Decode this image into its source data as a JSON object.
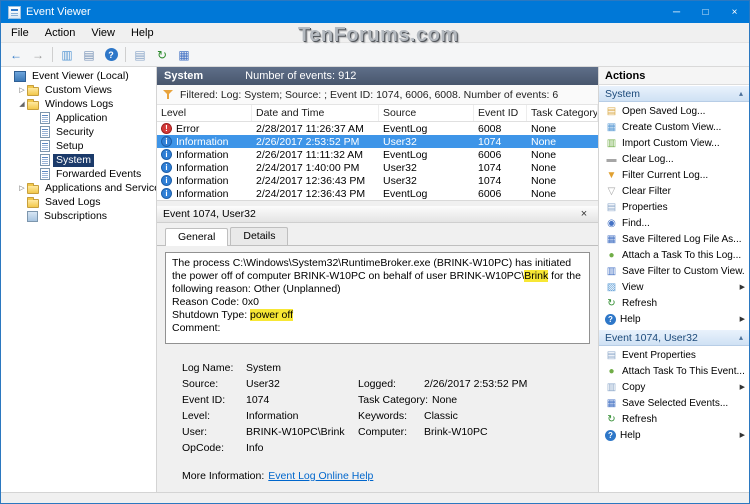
{
  "colors": {
    "titlebar": "#0078d7",
    "list_header_bar": "#4e5d76",
    "selection": "#3e95e8",
    "tree_selection": "#1b3a6a",
    "search_highlight": "#f7e735",
    "link": "#0066cc"
  },
  "window": {
    "title": "Event Viewer",
    "watermark": "TenForums.com",
    "menus": [
      "File",
      "Action",
      "View",
      "Help"
    ],
    "controls": [
      {
        "name": "minimize-button",
        "glyph": "─"
      },
      {
        "name": "maximize-button",
        "glyph": "□"
      },
      {
        "name": "close-button",
        "glyph": "×"
      }
    ]
  },
  "toolbar": [
    {
      "name": "back-icon",
      "glyph": "←",
      "color": "#2e77c8"
    },
    {
      "name": "forward-icon",
      "glyph": "→",
      "color": "#9a9a9a"
    },
    {
      "name": "separator"
    },
    {
      "name": "show-console-tree-icon",
      "glyph": "▥",
      "color": "#5b9bd5"
    },
    {
      "name": "export-list-icon",
      "glyph": "▤",
      "color": "#7a94b8"
    },
    {
      "name": "help-icon",
      "glyph": "?",
      "color": "#2e77c8",
      "circle": true
    },
    {
      "name": "separator"
    },
    {
      "name": "properties-icon",
      "glyph": "▤",
      "color": "#8aa6c8"
    },
    {
      "name": "refresh-icon",
      "glyph": "↻",
      "color": "#2e8b2e"
    },
    {
      "name": "save-icon",
      "glyph": "▦",
      "color": "#4472c4"
    }
  ],
  "tree": {
    "expander_glyphs": {
      "collapsed": "▷",
      "expanded": "◢"
    },
    "items": [
      {
        "label": "Event Viewer (Local)",
        "level": 0,
        "icon": "event-viewer-icon",
        "expander": ""
      },
      {
        "label": "Custom Views",
        "level": 1,
        "icon": "folder-icon",
        "expander": "collapsed"
      },
      {
        "label": "Windows Logs",
        "level": 1,
        "icon": "folder-icon",
        "expander": "expanded"
      },
      {
        "label": "Application",
        "level": 2,
        "icon": "log-icon",
        "expander": ""
      },
      {
        "label": "Security",
        "level": 2,
        "icon": "log-icon",
        "expander": ""
      },
      {
        "label": "Setup",
        "level": 2,
        "icon": "log-icon",
        "expander": ""
      },
      {
        "label": "System",
        "level": 2,
        "icon": "log-icon",
        "expander": "",
        "selected": true
      },
      {
        "label": "Forwarded Events",
        "level": 2,
        "icon": "log-icon",
        "expander": ""
      },
      {
        "label": "Applications and Services Logs",
        "level": 1,
        "icon": "folder-icon",
        "expander": "collapsed"
      },
      {
        "label": "Saved Logs",
        "level": 1,
        "icon": "folder-icon",
        "expander": ""
      },
      {
        "label": "Subscriptions",
        "level": 1,
        "icon": "subscriptions-icon",
        "expander": ""
      }
    ]
  },
  "list": {
    "title": "System",
    "events_count_label": "Number of events: 912",
    "filter_label": "Filtered: Log: System; Source: ; Event ID: 1074, 6006, 6008. Number of events: 6",
    "columns": [
      "Level",
      "Date and Time",
      "Source",
      "Event ID",
      "Task Category"
    ],
    "rows": [
      {
        "level": "Error",
        "datetime": "2/28/2017 11:26:37 AM",
        "source": "EventLog",
        "event_id": "6008",
        "task_category": "None"
      },
      {
        "level": "Information",
        "datetime": "2/26/2017 2:53:52 PM",
        "source": "User32",
        "event_id": "1074",
        "task_category": "None",
        "selected": true
      },
      {
        "level": "Information",
        "datetime": "2/26/2017 11:11:32 AM",
        "source": "EventLog",
        "event_id": "6006",
        "task_category": "None"
      },
      {
        "level": "Information",
        "datetime": "2/24/2017 1:40:00 PM",
        "source": "User32",
        "event_id": "1074",
        "task_category": "None"
      },
      {
        "level": "Information",
        "datetime": "2/24/2017 12:36:43 PM",
        "source": "User32",
        "event_id": "1074",
        "task_category": "None"
      },
      {
        "level": "Information",
        "datetime": "2/24/2017 12:36:43 PM",
        "source": "EventLog",
        "event_id": "6006",
        "task_category": "None"
      }
    ]
  },
  "detail": {
    "title": "Event 1074, User32",
    "close_glyph": "×",
    "tabs": [
      {
        "label": "General",
        "active": true
      },
      {
        "label": "Details",
        "active": false
      }
    ],
    "description": [
      [
        {
          "t": "The process C:\\Windows\\System32\\RuntimeBroker.exe (BRINK-W10PC) has initiated the power off of computer BRINK-W10PC on behalf of user BRINK-W10PC\\"
        },
        {
          "t": "Brink",
          "hl": true
        },
        {
          "t": " for the following reason: Other (Unplanned)"
        }
      ],
      [
        {
          "t": "Reason Code: 0x0"
        }
      ],
      [
        {
          "t": "Shutdown Type: "
        },
        {
          "t": "power off",
          "hl": true
        }
      ],
      [
        {
          "t": "Comment:"
        }
      ]
    ],
    "fields": [
      [
        {
          "label": "Log Name:",
          "value": "System"
        }
      ],
      [
        {
          "label": "Source:",
          "value": "User32"
        },
        {
          "label": "Logged:",
          "value": "2/26/2017 2:53:52 PM"
        }
      ],
      [
        {
          "label": "Event ID:",
          "value": "1074"
        },
        {
          "label": "Task Category:",
          "value": "None"
        }
      ],
      [
        {
          "label": "Level:",
          "value": "Information"
        },
        {
          "label": "Keywords:",
          "value": "Classic"
        }
      ],
      [
        {
          "label": "User:",
          "value": "BRINK-W10PC\\Brink"
        },
        {
          "label": "Computer:",
          "value": "Brink-W10PC"
        }
      ],
      [
        {
          "label": "OpCode:",
          "value": "Info"
        }
      ],
      [
        {
          "label": "More Information:",
          "value": "Event Log Online Help",
          "link": true
        }
      ]
    ]
  },
  "actions": {
    "title": "Actions",
    "collapse_glyph": "▴",
    "submenu_glyph": "▶",
    "sections": [
      {
        "title": "System",
        "items": [
          {
            "label": "Open Saved Log...",
            "icon": "open-saved-log-icon",
            "glyph": "▤",
            "color": "#d9a741"
          },
          {
            "label": "Create Custom View...",
            "icon": "create-custom-view-icon",
            "glyph": "▦",
            "color": "#5b9bd5"
          },
          {
            "label": "Import Custom View...",
            "icon": "import-custom-view-icon",
            "glyph": "▥",
            "color": "#70ad47"
          },
          {
            "label": "Clear Log...",
            "icon": "clear-log-icon",
            "glyph": "▬",
            "color": "#a6a6a6"
          },
          {
            "label": "Filter Current Log...",
            "icon": "filter-current-log-icon",
            "glyph": "▼",
            "color": "#e0a030"
          },
          {
            "label": "Clear Filter",
            "icon": "clear-filter-icon",
            "glyph": "▽",
            "color": "#a6a6a6"
          },
          {
            "label": "Properties",
            "icon": "properties-icon",
            "glyph": "▤",
            "color": "#8aa6c8"
          },
          {
            "label": "Find...",
            "icon": "find-icon",
            "glyph": "◉",
            "color": "#4472c4"
          },
          {
            "label": "Save Filtered Log File As...",
            "icon": "save-filtered-log-icon",
            "glyph": "▦",
            "color": "#4472c4"
          },
          {
            "label": "Attach a Task To this Log...",
            "icon": "attach-task-icon",
            "glyph": "●",
            "color": "#70ad47"
          },
          {
            "label": "Save Filter to Custom View...",
            "icon": "save-filter-to-custom-view-icon",
            "glyph": "▥",
            "color": "#4472c4"
          },
          {
            "label": "View",
            "icon": "view-icon",
            "glyph": "▨",
            "color": "#5b9bd5",
            "submenu": true
          },
          {
            "label": "Refresh",
            "icon": "refresh-icon",
            "glyph": "↻",
            "color": "#2e8b2e"
          },
          {
            "label": "Help",
            "icon": "help-icon",
            "glyph": "?",
            "color": "#2e77c8",
            "circle": true,
            "submenu": true
          }
        ]
      },
      {
        "title": "Event 1074, User32",
        "items": [
          {
            "label": "Event Properties",
            "icon": "event-properties-icon",
            "glyph": "▤",
            "color": "#8aa6c8"
          },
          {
            "label": "Attach Task To This Event...",
            "icon": "attach-task-event-icon",
            "glyph": "●",
            "color": "#70ad47"
          },
          {
            "label": "Copy",
            "icon": "copy-icon",
            "glyph": "▥",
            "color": "#8aa6c8",
            "submenu": true
          },
          {
            "label": "Save Selected Events...",
            "icon": "save-selected-events-icon",
            "glyph": "▦",
            "color": "#4472c4"
          },
          {
            "label": "Refresh",
            "icon": "refresh-icon",
            "glyph": "↻",
            "color": "#2e8b2e"
          },
          {
            "label": "Help",
            "icon": "help-icon",
            "glyph": "?",
            "color": "#2e77c8",
            "circle": true,
            "submenu": true
          }
        ]
      }
    ]
  }
}
